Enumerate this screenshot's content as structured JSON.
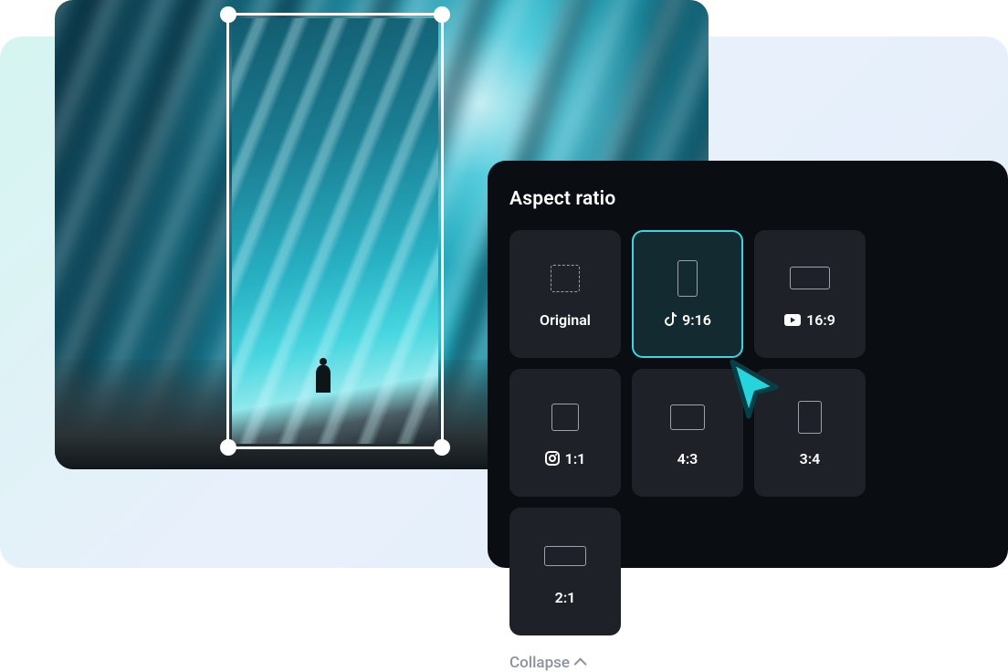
{
  "panel": {
    "title": "Aspect ratio",
    "collapse_label": "Collapse"
  },
  "ratios": [
    {
      "key": "original",
      "label": "Original",
      "platform": null,
      "shape": "original",
      "selected": false
    },
    {
      "key": "9-16",
      "label": "9:16",
      "platform": "tiktok",
      "shape": "916",
      "selected": true
    },
    {
      "key": "16-9",
      "label": "16:9",
      "platform": "youtube",
      "shape": "169",
      "selected": false
    },
    {
      "key": "1-1",
      "label": "1:1",
      "platform": "instagram",
      "shape": "11",
      "selected": false
    },
    {
      "key": "4-3",
      "label": "4:3",
      "platform": null,
      "shape": "43",
      "selected": false
    },
    {
      "key": "3-4",
      "label": "3:4",
      "platform": null,
      "shape": "34",
      "selected": false
    },
    {
      "key": "2-1",
      "label": "2:1",
      "platform": null,
      "shape": "21",
      "selected": false
    }
  ],
  "colors": {
    "panel_bg": "#0a0d12",
    "card_bg": "#1e2228",
    "accent": "#3dd6e0"
  }
}
